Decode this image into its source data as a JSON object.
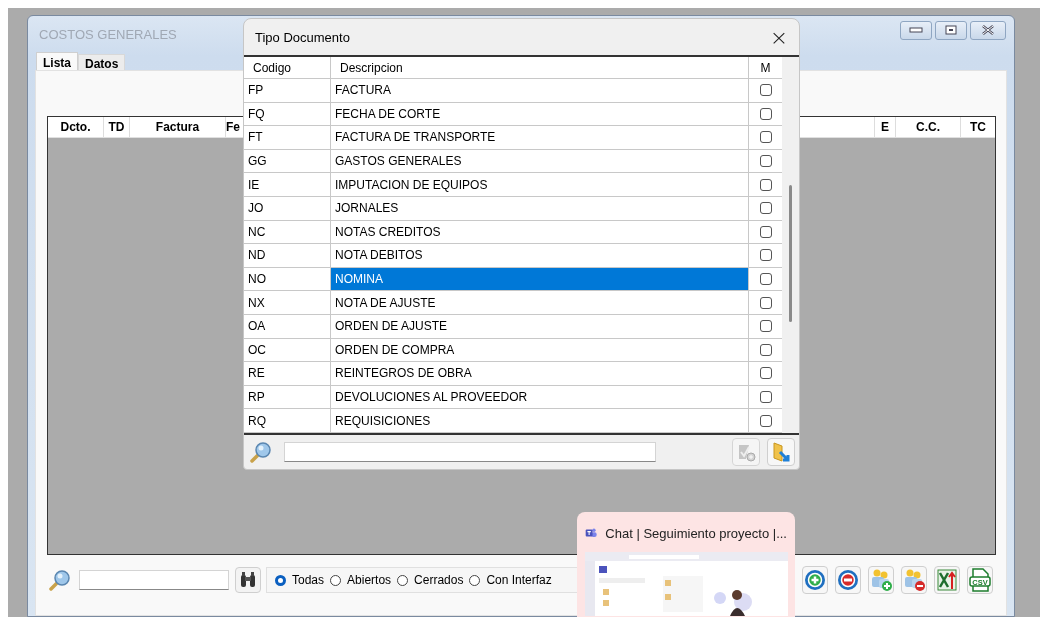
{
  "window": {
    "title": "COSTOS GENERALES"
  },
  "tabs": [
    {
      "label": "Lista",
      "selected": true
    },
    {
      "label": "Datos",
      "selected": false
    }
  ],
  "table": {
    "columns": [
      {
        "label": "Dcto.",
        "kind": "left"
      },
      {
        "label": "TD",
        "kind": "left"
      },
      {
        "label": "Factura",
        "kind": "left"
      },
      {
        "label": "Fe",
        "kind": "cut"
      },
      {
        "label": "E",
        "kind": "right"
      },
      {
        "label": "C.C.",
        "kind": "right"
      },
      {
        "label": "TC",
        "kind": "right"
      }
    ]
  },
  "toolbar": {
    "filters": [
      {
        "label": "Todas",
        "selected": true
      },
      {
        "label": "Abiertos",
        "selected": false
      },
      {
        "label": "Cerrados",
        "selected": false
      },
      {
        "label": "Con Interfaz",
        "selected": false
      }
    ],
    "csv_label": "CSV"
  },
  "dialog": {
    "title": "Tipo Documento",
    "close": "×",
    "columns": [
      "Codigo",
      "Descripcion",
      "M"
    ],
    "rows": [
      {
        "code": "FP",
        "description": "FACTURA",
        "checked": false,
        "selected": false
      },
      {
        "code": "FQ",
        "description": "FECHA DE CORTE",
        "checked": false,
        "selected": false
      },
      {
        "code": "FT",
        "description": "FACTURA DE TRANSPORTE",
        "checked": false,
        "selected": false
      },
      {
        "code": "GG",
        "description": "GASTOS GENERALES",
        "checked": false,
        "selected": false
      },
      {
        "code": "IE",
        "description": "IMPUTACION DE EQUIPOS",
        "checked": false,
        "selected": false
      },
      {
        "code": "JO",
        "description": "JORNALES",
        "checked": false,
        "selected": false
      },
      {
        "code": "NC",
        "description": "NOTAS CREDITOS",
        "checked": false,
        "selected": false
      },
      {
        "code": "ND",
        "description": "NOTA DEBITOS",
        "checked": false,
        "selected": false
      },
      {
        "code": "NO",
        "description": "NOMINA",
        "checked": false,
        "selected": true
      },
      {
        "code": "NX",
        "description": "NOTA DE AJUSTE",
        "checked": false,
        "selected": false
      },
      {
        "code": "OA",
        "description": "ORDEN DE AJUSTE",
        "checked": false,
        "selected": false
      },
      {
        "code": "OC",
        "description": "ORDEN DE COMPRA",
        "checked": false,
        "selected": false
      },
      {
        "code": "RE",
        "description": "REINTEGROS DE OBRA",
        "checked": false,
        "selected": false
      },
      {
        "code": "RP",
        "description": "DEVOLUCIONES AL PROVEEDOR",
        "checked": false,
        "selected": false
      },
      {
        "code": "RQ",
        "description": "REQUISICIONES",
        "checked": false,
        "selected": false
      }
    ]
  },
  "taskbar_preview": {
    "title": "Chat | Seguimiento proyecto |..."
  }
}
